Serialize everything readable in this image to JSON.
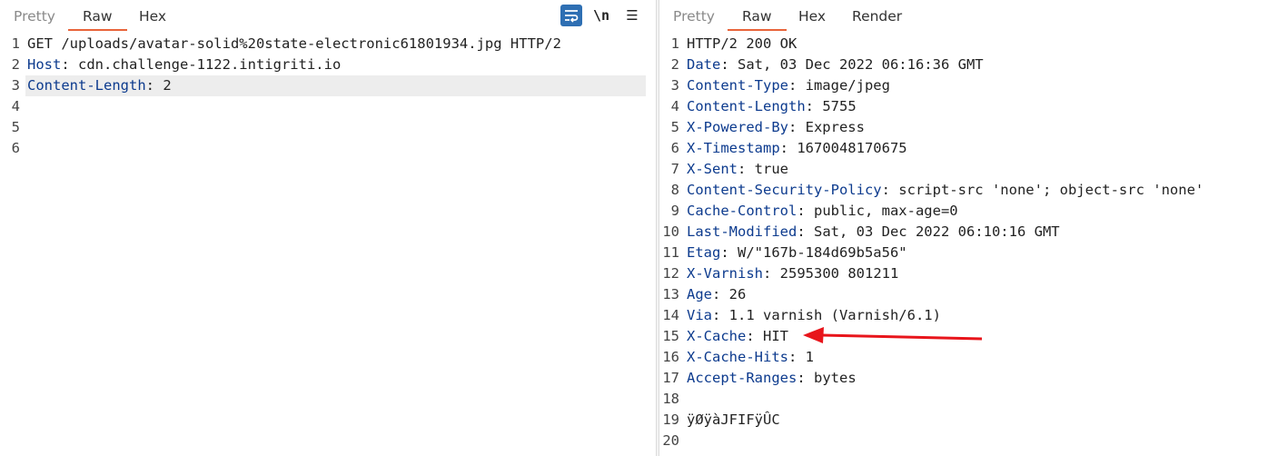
{
  "request": {
    "tabs": [
      {
        "label": "Pretty",
        "active": false
      },
      {
        "label": "Raw",
        "active": true
      },
      {
        "label": "Hex",
        "active": false
      }
    ],
    "tools": {
      "wrap_icon": "wrap-lines-icon",
      "newline_label": "\\n",
      "menu_icon": "hamburger-menu-icon"
    },
    "lines": [
      {
        "num": "1",
        "key": "",
        "rest": "GET /uploads/avatar-solid%20state-electronic61801934.jpg HTTP/2"
      },
      {
        "num": "2",
        "key": "Host",
        "rest": ": cdn.challenge-1122.intigriti.io"
      },
      {
        "num": "3",
        "key": "Content-Length",
        "rest": ": 2"
      },
      {
        "num": "4",
        "key": "",
        "rest": ""
      },
      {
        "num": "5",
        "key": "",
        "rest": ""
      },
      {
        "num": "6",
        "key": "",
        "rest": ""
      }
    ]
  },
  "response": {
    "tabs": [
      {
        "label": "Pretty",
        "active": false
      },
      {
        "label": "Raw",
        "active": true
      },
      {
        "label": "Hex",
        "active": false
      },
      {
        "label": "Render",
        "active": false
      }
    ],
    "lines": [
      {
        "num": "1",
        "key": "",
        "rest": "HTTP/2 200 OK"
      },
      {
        "num": "2",
        "key": "Date",
        "rest": ": Sat, 03 Dec 2022 06:16:36 GMT"
      },
      {
        "num": "3",
        "key": "Content-Type",
        "rest": ": image/jpeg"
      },
      {
        "num": "4",
        "key": "Content-Length",
        "rest": ": 5755"
      },
      {
        "num": "5",
        "key": "X-Powered-By",
        "rest": ": Express"
      },
      {
        "num": "6",
        "key": "X-Timestamp",
        "rest": ": 1670048170675"
      },
      {
        "num": "7",
        "key": "X-Sent",
        "rest": ": true"
      },
      {
        "num": "8",
        "key": "Content-Security-Policy",
        "rest": ": script-src 'none'; object-src 'none'"
      },
      {
        "num": "9",
        "key": "Cache-Control",
        "rest": ": public, max-age=0"
      },
      {
        "num": "10",
        "key": "Last-Modified",
        "rest": ": Sat, 03 Dec 2022 06:10:16 GMT"
      },
      {
        "num": "11",
        "key": "Etag",
        "rest": ": W/\"167b-184d69b5a56\""
      },
      {
        "num": "12",
        "key": "X-Varnish",
        "rest": ": 2595300 801211"
      },
      {
        "num": "13",
        "key": "Age",
        "rest": ": 26"
      },
      {
        "num": "14",
        "key": "Via",
        "rest": ": 1.1 varnish (Varnish/6.1)"
      },
      {
        "num": "15",
        "key": "X-Cache",
        "rest": ": HIT"
      },
      {
        "num": "16",
        "key": "X-Cache-Hits",
        "rest": ": 1"
      },
      {
        "num": "17",
        "key": "Accept-Ranges",
        "rest": ": bytes"
      },
      {
        "num": "18",
        "key": "",
        "rest": ""
      },
      {
        "num": "19",
        "key": "",
        "rest": "ÿØÿàJFIFÿÛC"
      },
      {
        "num": "20",
        "key": "",
        "rest": ""
      }
    ]
  },
  "colors": {
    "accent": "#e8643a",
    "header_key": "#0d3b8e",
    "annotation_arrow": "#e8151b",
    "wrap_button": "#2e6fb3"
  }
}
